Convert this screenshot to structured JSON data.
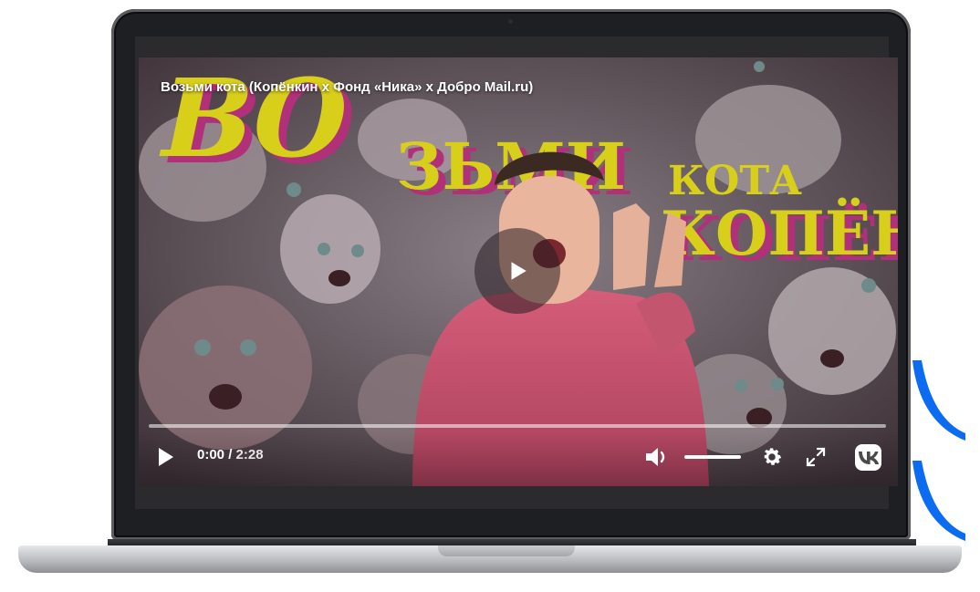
{
  "player": {
    "title": "Возьми кота (Копёнкин х Фонд «Ника» х Добро Mail.ru)",
    "time_current": "0:00",
    "time_separator": " / ",
    "time_duration": "2:28",
    "progress_fraction": 0,
    "volume_fraction": 1,
    "icons": {
      "play_big": "play-icon",
      "play_small": "play-icon",
      "volume": "volume-icon",
      "settings": "gear-icon",
      "fullscreen": "fullscreen-icon",
      "brand": "vk-logo-icon"
    }
  },
  "poster": {
    "line1": "ВОЗЬМИ КОТА",
    "line2": "КОПЁНКИН"
  },
  "colors": {
    "swoosh_blue": "#0b6cf2",
    "poster_yellow": "#d8cf1b",
    "poster_magenta": "#b0307a",
    "hoodie": "#c8506b"
  }
}
